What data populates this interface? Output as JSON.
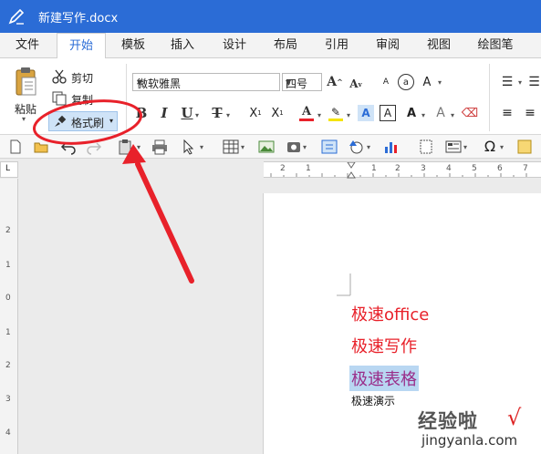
{
  "titlebar": {
    "title": "新建写作.docx",
    "icon": "pen-icon"
  },
  "tabs": [
    {
      "label": "文件"
    },
    {
      "label": "开始"
    },
    {
      "label": "模板"
    },
    {
      "label": "插入"
    },
    {
      "label": "设计"
    },
    {
      "label": "布局"
    },
    {
      "label": "引用"
    },
    {
      "label": "审阅"
    },
    {
      "label": "视图"
    },
    {
      "label": "绘图笔"
    }
  ],
  "ribbon": {
    "paste_label": "粘贴",
    "cut_label": "剪切",
    "copy_label": "复制",
    "format_painter_label": "格式刷",
    "font_name": "微软雅黑",
    "font_size": "四号",
    "font_color": "#e8212a",
    "highlight_color": "#f5e400"
  },
  "document": {
    "lines": [
      "极速office",
      "极速写作",
      "极速表格",
      "极速演示"
    ]
  },
  "watermark": {
    "line1": "经验啦",
    "line2": "jingyanla.com",
    "check": "√"
  },
  "colors": {
    "accent": "#2b6cd6",
    "annotation": "#e8212a",
    "selection": "#b9d7f2"
  }
}
